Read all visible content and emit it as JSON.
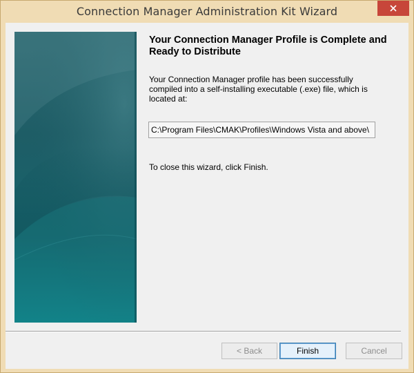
{
  "window": {
    "title": "Connection Manager Administration Kit Wizard",
    "close_icon": "close-icon"
  },
  "content": {
    "heading": "Your Connection Manager Profile is Complete and Ready to Distribute",
    "description": "Your Connection Manager profile has been successfully compiled into a self-installing executable (.exe) file, which is located at:",
    "path_value": "C:\\Program Files\\CMAK\\Profiles\\Windows Vista and above\\",
    "instruction": "To close this wizard, click Finish."
  },
  "buttons": {
    "back": "< Back",
    "finish": "Finish",
    "cancel": "Cancel"
  },
  "colors": {
    "titlebar": "#f0dcb4",
    "close_button": "#c7463a",
    "banner_dark": "#1e5d66",
    "banner_light": "#128a90"
  }
}
